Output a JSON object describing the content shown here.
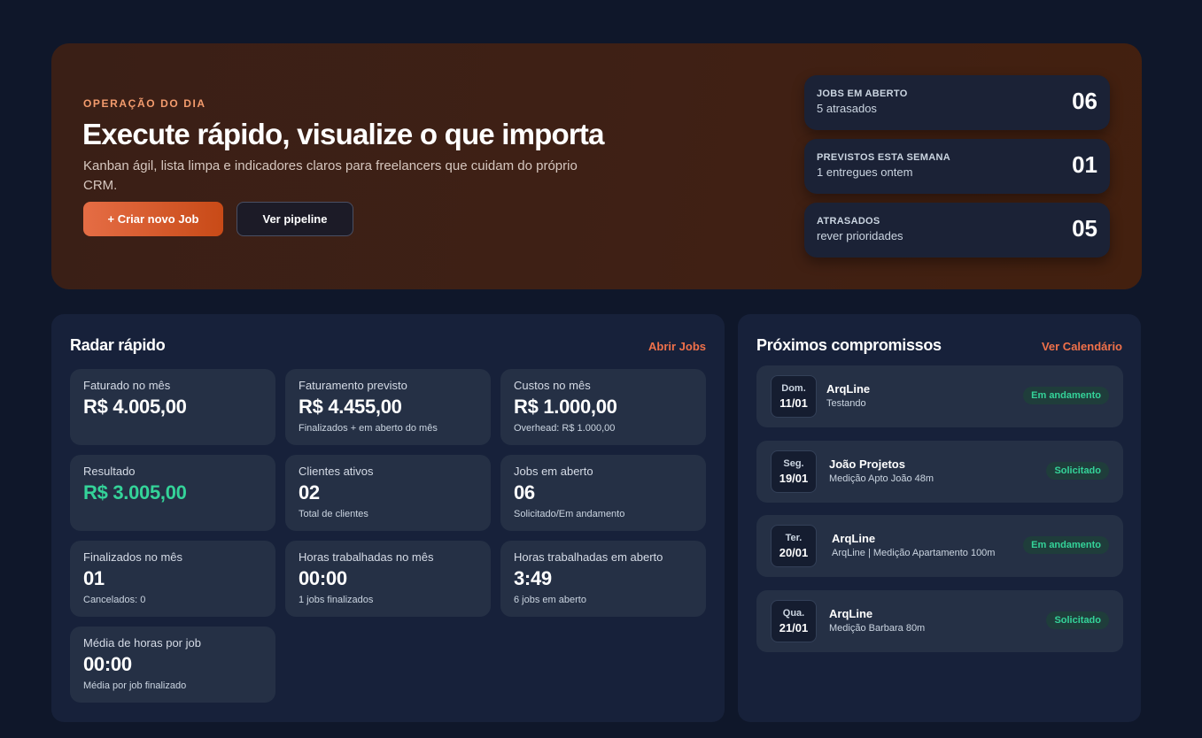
{
  "hero": {
    "eyebrow": "OPERAÇÃO DO DIA",
    "title": "Execute rápido, visualize o que importa",
    "description": "Kanban ágil, lista limpa e indicadores claros para freelancers que cuidam do próprio CRM.",
    "primary_button": "+ Criar novo Job",
    "secondary_button": "Ver pipeline",
    "stats": [
      {
        "label": "JOBS EM ABERTO",
        "sub": "5 atrasados",
        "value": "06"
      },
      {
        "label": "PREVISTOS ESTA SEMANA",
        "sub": "1 entregues ontem",
        "value": "01"
      },
      {
        "label": "ATRASADOS",
        "sub": "rever prioridades",
        "value": "05"
      }
    ]
  },
  "radar": {
    "title": "Radar rápido",
    "link": "Abrir Jobs",
    "metrics": [
      {
        "label": "Faturado no mês",
        "value": "R$ 4.005,00",
        "sub": ""
      },
      {
        "label": "Faturamento previsto",
        "value": "R$ 4.455,00",
        "sub": "Finalizados + em aberto do mês"
      },
      {
        "label": "Custos no mês",
        "value": "R$ 1.000,00",
        "sub": "Overhead: R$ 1.000,00"
      },
      {
        "label": "Resultado",
        "value": "R$ 3.005,00",
        "sub": ""
      },
      {
        "label": "Clientes ativos",
        "value": "02",
        "sub": "Total de clientes"
      },
      {
        "label": "Jobs em aberto",
        "value": "06",
        "sub": "Solicitado/Em andamento"
      },
      {
        "label": "Finalizados no mês",
        "value": "01",
        "sub": "Cancelados: 0"
      },
      {
        "label": "Horas trabalhadas no mês",
        "value": "00:00",
        "sub": "1 jobs finalizados"
      },
      {
        "label": "Horas trabalhadas em aberto",
        "value": "3:49",
        "sub": "6 jobs em aberto"
      },
      {
        "label": "Média de horas por job",
        "value": "00:00",
        "sub": "Média por job finalizado"
      }
    ]
  },
  "agenda": {
    "title": "Próximos compromissos",
    "link": "Ver Calendário",
    "items": [
      {
        "weekday": "Dom.",
        "date": "11/01",
        "title": "ArqLine",
        "sub": "Testando",
        "status": "Em andamento"
      },
      {
        "weekday": "Seg.",
        "date": "19/01",
        "title": "João Projetos",
        "sub": "Medição Apto João 48m",
        "status": "Solicitado"
      },
      {
        "weekday": "Ter.",
        "date": "20/01",
        "title": "ArqLine",
        "sub": "ArqLine | Medição Apartamento 100m",
        "status": "Em andamento"
      },
      {
        "weekday": "Qua.",
        "date": "21/01",
        "title": "ArqLine",
        "sub": "Medição Barbara 80m",
        "status": "Solicitado"
      }
    ]
  },
  "colors": {
    "background": "#0f172a",
    "accent": "#f0714a",
    "positive": "#34d399"
  }
}
